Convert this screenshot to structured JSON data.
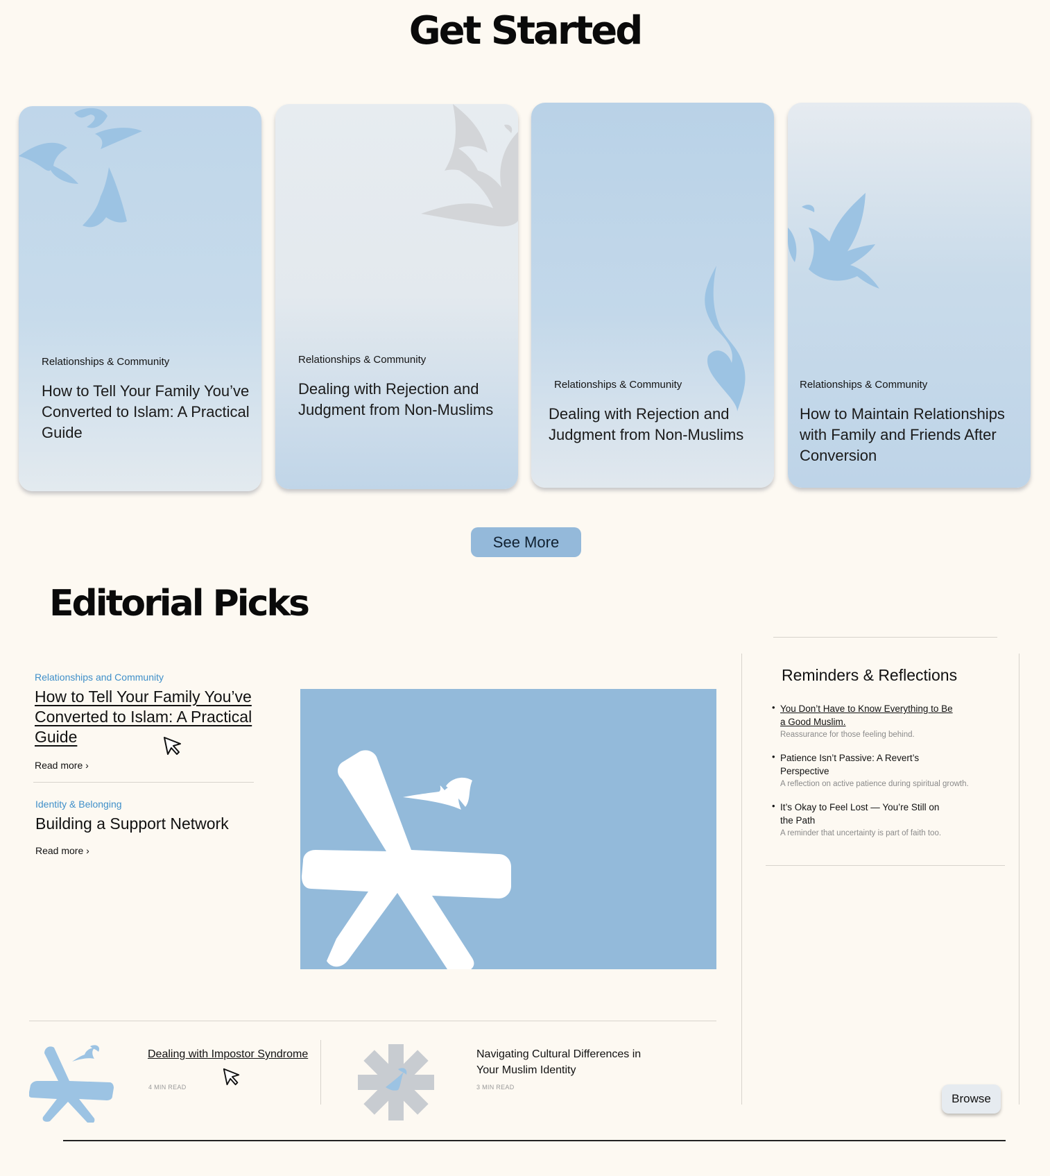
{
  "get_started": {
    "title": "Get Started",
    "cards": [
      {
        "category": "Relationships & Community",
        "title": "How to Tell Your Family You’ve Converted to Islam: A Practical Guide"
      },
      {
        "category": "Relationships & Community",
        "title": "Dealing with Rejection and Judgment from Non-Muslims"
      },
      {
        "category": "Relationships & Community",
        "title": "Dealing with Rejection and Judgment from Non-Muslims"
      },
      {
        "category": "Relationships & Community",
        "title": "How to Maintain Relationships with Family and Friends After Conversion"
      }
    ],
    "see_more_label": "See More"
  },
  "editorial": {
    "title": "Editorial Picks",
    "main": {
      "category": "Relationships and Community",
      "title": "How to Tell Your Family You’ve Converted to Islam: A Practical Guide",
      "read_more": "Read more ›"
    },
    "second": {
      "category": "Identity & Belonging",
      "title": "Building a Support Network",
      "read_more": "Read more ›"
    },
    "mini": [
      {
        "title": "Dealing with Impostor Syndrome",
        "meta": "4 MIN READ"
      },
      {
        "title": "Navigating Cultural Differences in Your Muslim Identity",
        "meta": "3 MIN READ"
      }
    ]
  },
  "sidebar": {
    "title": "Reminders & Reflections",
    "items": [
      {
        "title": "You Don’t Have to Know Everything to Be a Good Muslim.",
        "desc": "Reassurance for those feeling behind."
      },
      {
        "title": "Patience Isn’t Passive: A Revert’s Perspective",
        "desc": "A reflection on active patience during spiritual growth."
      },
      {
        "title": "It’s Okay to Feel Lost — You’re Still on the Path",
        "desc": "A reminder that uncertainty is part of faith too."
      }
    ]
  },
  "browse_label": "Browse",
  "colors": {
    "background": "#fdf9f2",
    "accent_blue": "#93bada",
    "category_blue": "#3f8fc9",
    "gray_motif": "#c8ccd1"
  }
}
